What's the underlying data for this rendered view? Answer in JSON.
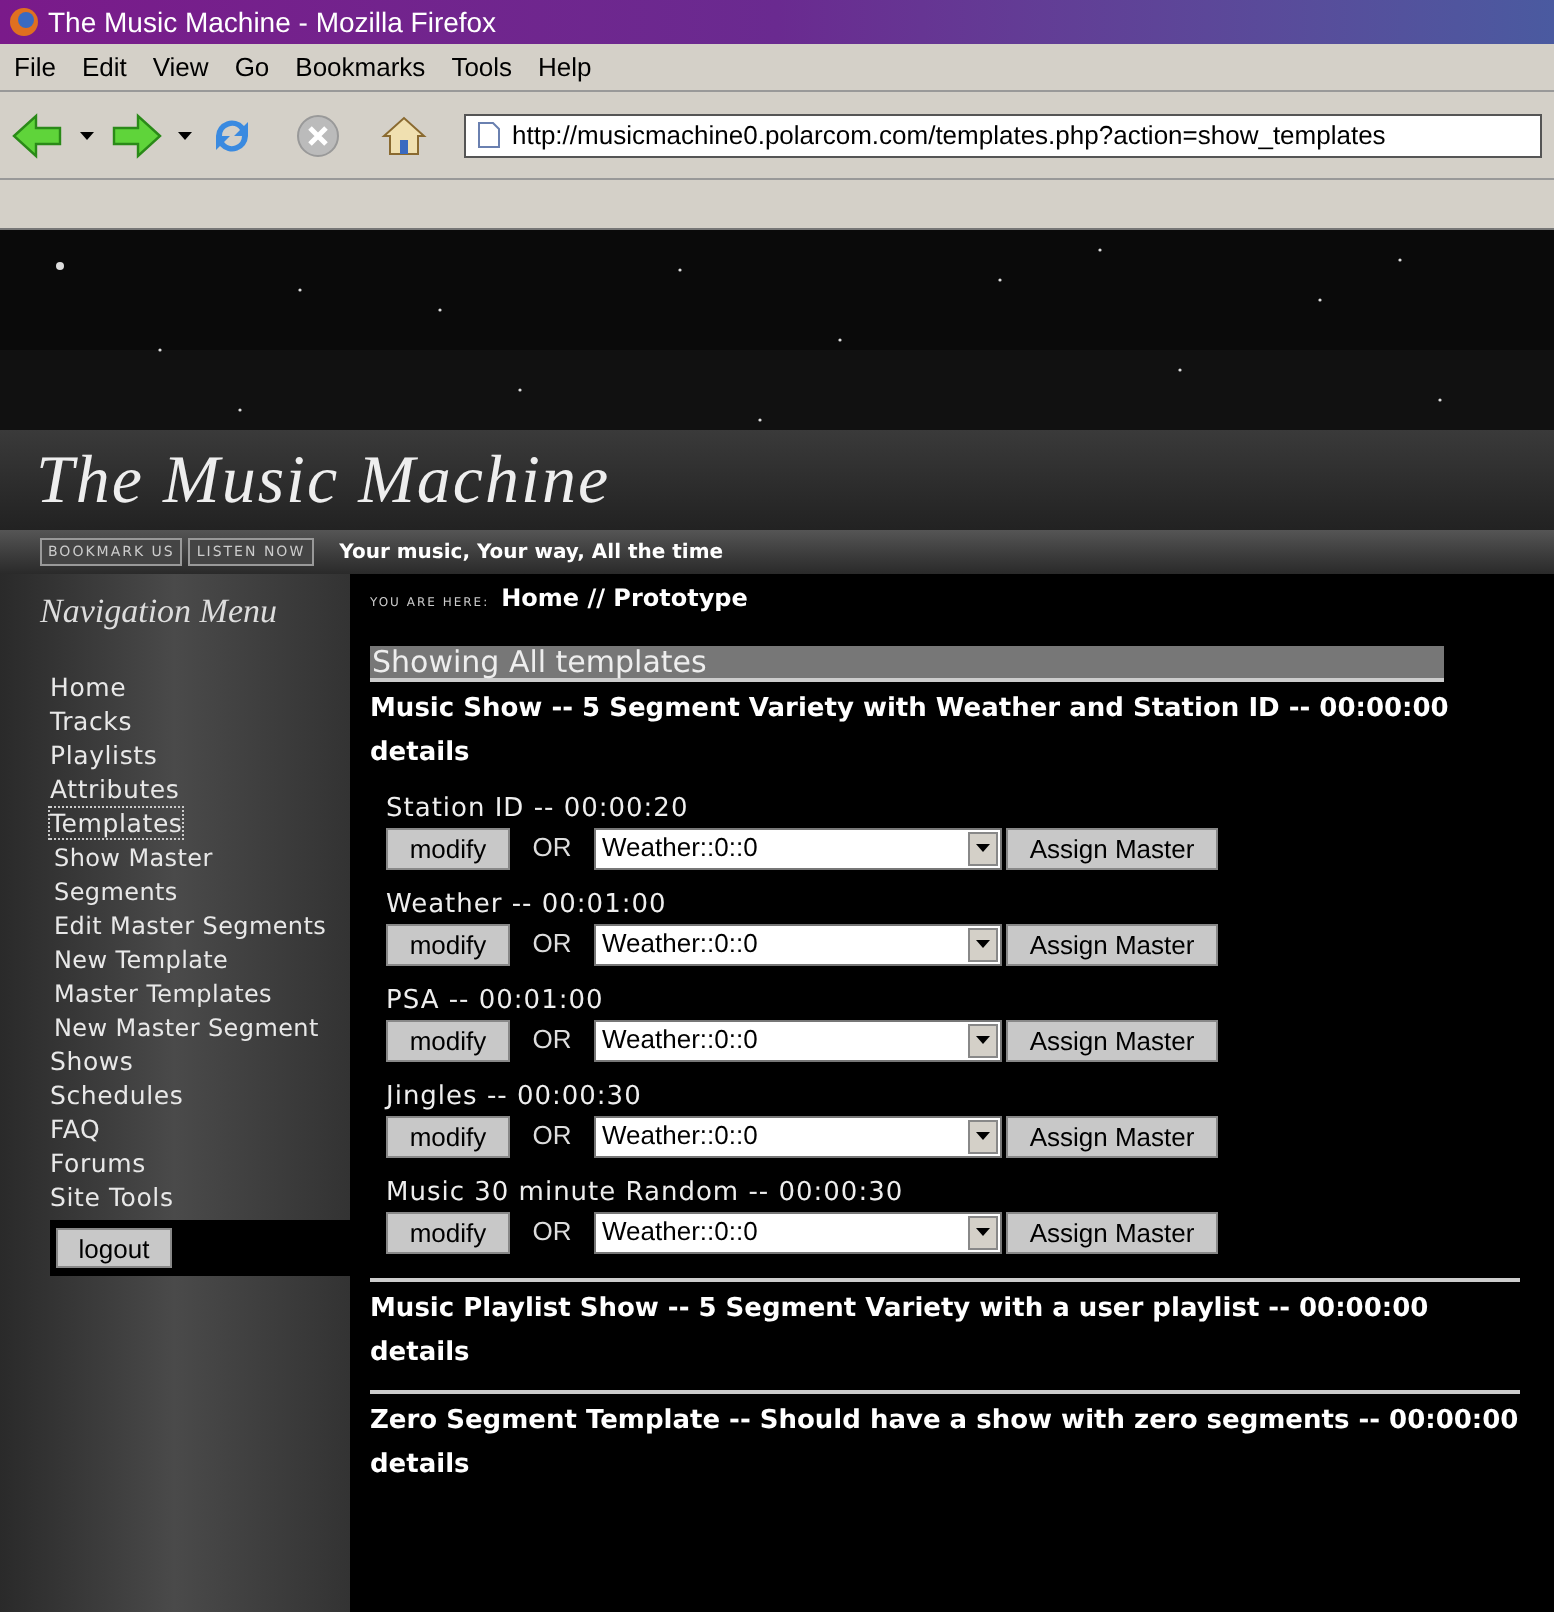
{
  "window": {
    "title": "The Music Machine - Mozilla Firefox"
  },
  "menu": [
    "File",
    "Edit",
    "View",
    "Go",
    "Bookmarks",
    "Tools",
    "Help"
  ],
  "address": {
    "url": "http://musicmachine0.polarcom.com/templates.php?action=show_templates"
  },
  "header": {
    "logo": "The Music Machine"
  },
  "topbar": {
    "buttons": [
      "BOOKMARK US",
      "LISTEN NOW"
    ],
    "tagline": "Your music, Your way, All the time"
  },
  "sidebar": {
    "heading": "Navigation Menu",
    "items": [
      {
        "label": "Home",
        "selected": false
      },
      {
        "label": "Tracks",
        "selected": false
      },
      {
        "label": "Playlists",
        "selected": false
      },
      {
        "label": "Attributes",
        "selected": false
      },
      {
        "label": "Templates",
        "selected": true,
        "children": [
          {
            "label": "Show Master"
          },
          {
            "label": "Segments"
          },
          {
            "label": "Edit Master Segments"
          },
          {
            "label": "New Template"
          },
          {
            "label": "Master Templates"
          },
          {
            "label": "New Master Segment"
          }
        ]
      },
      {
        "label": "Shows",
        "selected": false
      },
      {
        "label": "Schedules",
        "selected": false
      },
      {
        "label": "FAQ",
        "selected": false
      },
      {
        "label": "Forums",
        "selected": false
      },
      {
        "label": "Site Tools",
        "selected": false
      }
    ],
    "logout": "logout"
  },
  "breadcrumb": {
    "label": "YOU ARE HERE:",
    "path": "Home // Prototype"
  },
  "section_title": "Showing All templates",
  "templates": [
    {
      "title": "Music Show -- 5 Segment Variety with Weather and Station ID -- 00:00:00",
      "link": "details",
      "segments": [
        {
          "label": "Station ID -- 00:00:20",
          "modify": "modify",
          "or": "OR",
          "value": "Weather::0::0",
          "assign": "Assign Master"
        },
        {
          "label": "Weather -- 00:01:00",
          "modify": "modify",
          "or": "OR",
          "value": "Weather::0::0",
          "assign": "Assign Master"
        },
        {
          "label": "PSA -- 00:01:00",
          "modify": "modify",
          "or": "OR",
          "value": "Weather::0::0",
          "assign": "Assign Master"
        },
        {
          "label": "Jingles -- 00:00:30",
          "modify": "modify",
          "or": "OR",
          "value": "Weather::0::0",
          "assign": "Assign Master"
        },
        {
          "label": "Music 30 minute Random -- 00:00:30",
          "modify": "modify",
          "or": "OR",
          "value": "Weather::0::0",
          "assign": "Assign Master"
        }
      ]
    },
    {
      "title": "Music Playlist Show -- 5 Segment Variety with a user playlist -- 00:00:00",
      "link": "details"
    },
    {
      "title": "Zero Segment Template -- Should have a show with zero segments -- 00:00:00",
      "link": "details"
    }
  ]
}
